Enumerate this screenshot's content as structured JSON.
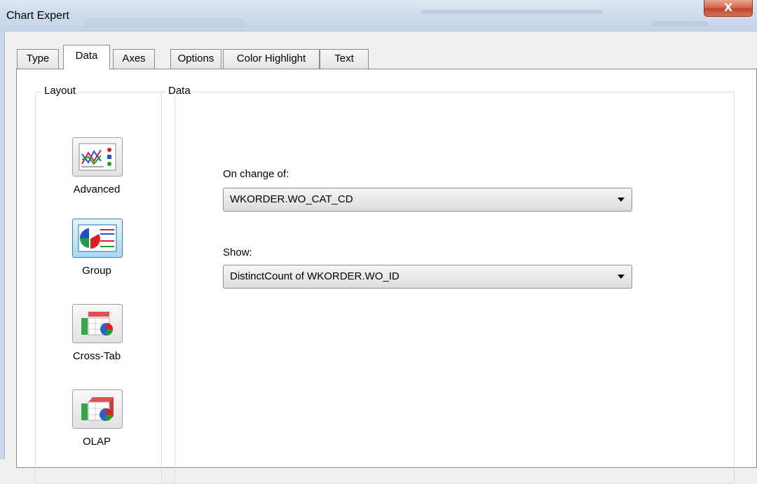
{
  "window": {
    "title": "Chart Expert",
    "close_glyph": "X"
  },
  "tabs": [
    {
      "label": "Type"
    },
    {
      "label": "Data",
      "active": true
    },
    {
      "label": "Axes"
    },
    {
      "label": "Options"
    },
    {
      "label": "Color Highlight"
    },
    {
      "label": "Text"
    }
  ],
  "layout": {
    "group_label": "Layout",
    "items": [
      {
        "label": "Advanced",
        "icon": "advanced-chart-icon"
      },
      {
        "label": "Group",
        "icon": "group-chart-icon",
        "selected": true
      },
      {
        "label": "Cross-Tab",
        "icon": "cross-tab-chart-icon"
      },
      {
        "label": "OLAP",
        "icon": "olap-chart-icon"
      }
    ]
  },
  "data": {
    "group_label": "Data",
    "on_change_label": "On change of:",
    "on_change_value": "WKORDER.WO_CAT_CD",
    "show_label": "Show:",
    "show_value": "DistinctCount of WKORDER.WO_ID"
  },
  "colors": {
    "selected_border": "#3c7fb1",
    "close_red": "#c2442a"
  }
}
